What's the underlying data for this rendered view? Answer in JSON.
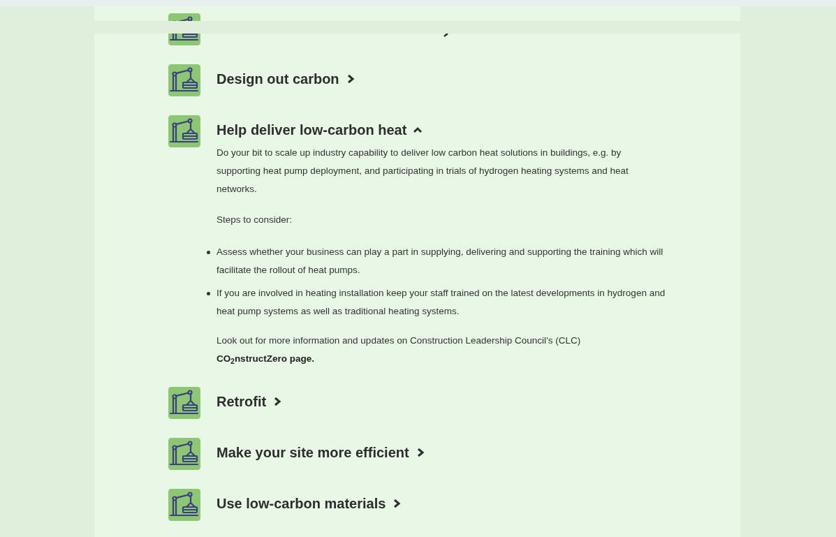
{
  "items": [
    {
      "expanded": false
    },
    {
      "title": "Design out carbon",
      "expanded": false
    },
    {
      "title": "Help deliver low-carbon heat",
      "expanded": true,
      "content": {
        "intro": "Do your bit to scale up industry capability to deliver low carbon heat solutions in buildings, e.g. by supporting heat pump deployment, and participating in trials of hydrogen heating systems and heat networks.",
        "steps_heading": "Steps to consider:",
        "bullets": [
          "Assess whether your business can play a part in supplying, delivering and supporting the training which will facilitate the rollout of heat pumps.",
          "If you are involved in heating installation keep your staff trained on the latest developments in hydrogen and heat pump systems as well as traditional heating systems."
        ],
        "note": "Look out for more information and updates on Construction Leadership Council’s (CLC)",
        "note_link": "CO$_{2}$nstructZero page."
      }
    },
    {
      "title": "Retrofit",
      "expanded": false
    },
    {
      "title": "Make your site more efficient",
      "expanded": false
    },
    {
      "title": "Use low-carbon materials",
      "expanded": false
    }
  ]
}
